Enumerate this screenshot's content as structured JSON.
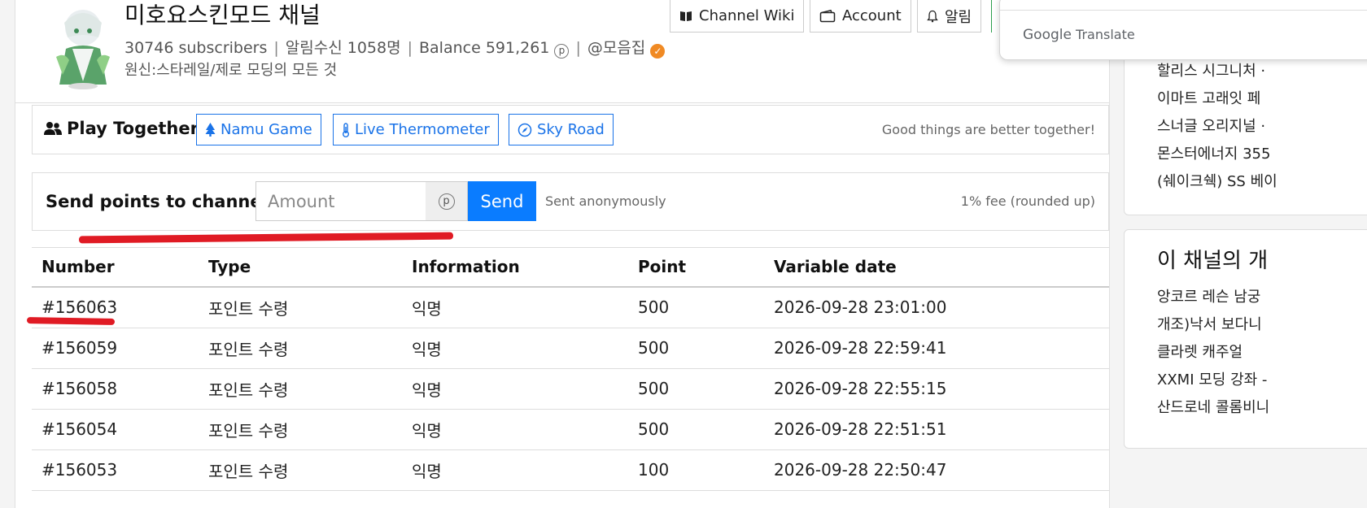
{
  "channel": {
    "title": "미호요스킨모드 채널",
    "subscribers": "30746 subscribers",
    "notify_count": "알림수신 1058명",
    "balance": "Balance 591,261",
    "handle": "@모음집",
    "description": "원신:스타레일/제로 모딩의 모든 것"
  },
  "header_buttons": {
    "wiki": "Channel Wiki",
    "account": "Account",
    "alerts": "알림"
  },
  "play_together": {
    "title": "Play Together",
    "links": [
      "Namu Game",
      "Live Thermometer",
      "Sky Road"
    ],
    "note": "Good things are better together!"
  },
  "send_points": {
    "title": "Send points to channel",
    "amount_placeholder": "Amount",
    "addon_glyph": "p",
    "send_label": "Send",
    "anon_note": "Sent anonymously",
    "fee_note": "1% fee (rounded up)"
  },
  "table": {
    "headers": [
      "Number",
      "Type",
      "Information",
      "Point",
      "Variable date"
    ],
    "rows": [
      [
        "#156063",
        "포인트 수령",
        "익명",
        "500",
        "2026-09-28 23:01:00"
      ],
      [
        "#156059",
        "포인트 수령",
        "익명",
        "500",
        "2026-09-28 22:59:41"
      ],
      [
        "#156058",
        "포인트 수령",
        "익명",
        "500",
        "2026-09-28 22:55:15"
      ],
      [
        "#156054",
        "포인트 수령",
        "익명",
        "500",
        "2026-09-28 22:51:51"
      ],
      [
        "#156053",
        "포인트 수령",
        "익명",
        "100",
        "2026-09-28 22:50:47"
      ]
    ]
  },
  "sidebar": {
    "top_items": [
      "할리스 시그니처 ·",
      "이마트 고래잇 페",
      "스너글 오리지널 ·",
      "몬스터에너지 355",
      "(쉐이크쉑) SS 베이"
    ],
    "channel_heading": "이 채널의 개",
    "channel_items": [
      "앙코르 레슨 남궁",
      "개조)낙서 보다니",
      "클라렛 캐주얼",
      "XXMI 모딩 강좌 -",
      "산드로네 콜롬비니"
    ]
  },
  "google_translate": {
    "brand_google": "Google",
    "brand_translate": "Translate"
  },
  "colors": {
    "accent": "#0a7cff",
    "link": "#1a73e8",
    "verified": "#f08a24",
    "annotation": "#e01b24"
  }
}
